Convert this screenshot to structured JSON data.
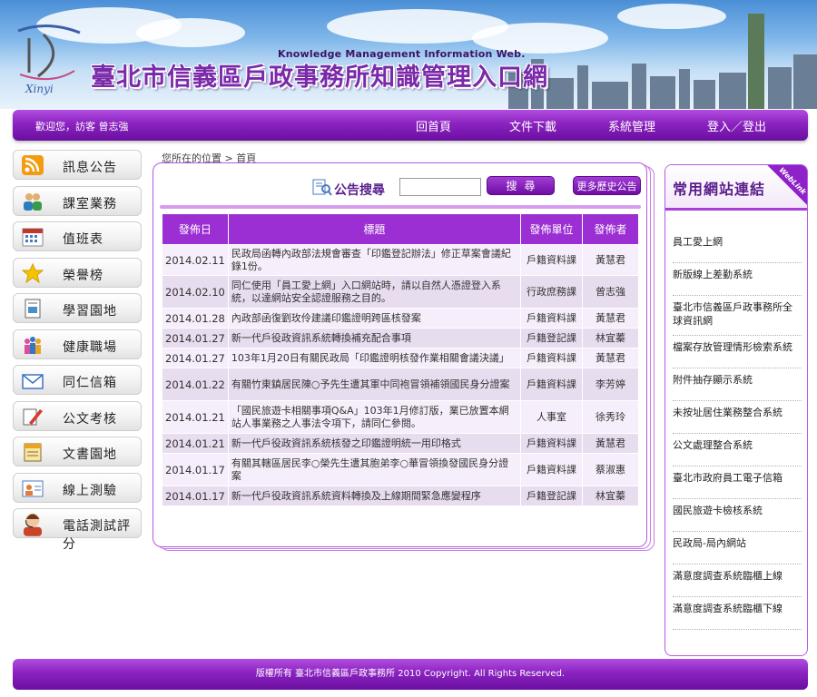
{
  "header": {
    "brand_en": "Knowledge Management Information Web.",
    "brand_zh": "臺北市信義區戶政事務所知識管理入口網",
    "logo_text": "Xinyi"
  },
  "nav": {
    "welcome": "歡迎您，訪客 曾志強",
    "home": "回首頁",
    "files": "文件下載",
    "admin": "系統管理",
    "login": "登入／登出"
  },
  "menu": [
    {
      "label": "訊息公告",
      "icon": "rss-icon",
      "color": "#f39c12"
    },
    {
      "label": "課室業務",
      "icon": "people-icon",
      "color": "#2e7bbf"
    },
    {
      "label": "值班表",
      "icon": "calendar-icon",
      "color": "#c0392b"
    },
    {
      "label": "榮譽榜",
      "icon": "star-icon",
      "color": "#f5c400"
    },
    {
      "label": "學習園地",
      "icon": "document-icon",
      "color": "#4a90c8"
    },
    {
      "label": "健康職場",
      "icon": "group-icon",
      "color": "#d64fa0"
    },
    {
      "label": "同仁信箱",
      "icon": "mail-icon",
      "color": "#3a73c6"
    },
    {
      "label": "公文考核",
      "icon": "pencil-icon",
      "color": "#d63a2a"
    },
    {
      "label": "文書園地",
      "icon": "notebook-icon",
      "color": "#e8a523"
    },
    {
      "label": "線上測驗",
      "icon": "user-card-icon",
      "color": "#e07b39"
    },
    {
      "label": "電話測試評分",
      "icon": "operator-icon",
      "color": "#c8452a"
    }
  ],
  "breadcrumb": "您所在的位置 > 首頁",
  "search": {
    "label": "公告搜尋",
    "placeholder": "",
    "button": "搜尋",
    "history_button": "更多歷史公告"
  },
  "table": {
    "headers": [
      "發佈日",
      "標題",
      "發佈單位",
      "發佈者"
    ],
    "rows": [
      {
        "date": "2014.02.11",
        "title": "民政局函轉內政部法規會審查「印鑑登記辦法」修正草案會議紀錄1份。",
        "unit": "戶籍資料課",
        "author": "黃慧君"
      },
      {
        "date": "2014.02.10",
        "title": "同仁使用「員工愛上網」入口網站時，請以自然人憑證登入系統，以達網站安全認證服務之目的。",
        "unit": "行政庶務課",
        "author": "曾志強"
      },
      {
        "date": "2014.01.28",
        "title": "內政部函復劉玫伶建議印鑑證明跨區核發案",
        "unit": "戶籍資料課",
        "author": "黃慧君"
      },
      {
        "date": "2014.01.27",
        "title": "新一代戶役政資訊系統轉換補充配合事項",
        "unit": "戶籍登記課",
        "author": "林宜蓁"
      },
      {
        "date": "2014.01.27",
        "title": "103年1月20日有關民政局「印鑑證明核發作業相關會議決議」",
        "unit": "戶籍資料課",
        "author": "黃慧君"
      },
      {
        "date": "2014.01.22",
        "title": "有關竹東鎮居民陳○予先生遭其軍中同袍冒領補領國民身分證案",
        "unit": "戶籍資料課",
        "author": "李芳婷"
      },
      {
        "date": "2014.01.21",
        "title": "「國民旅遊卡相關事項Q&A」103年1月修訂版，業已放置本網站人事業務之人事法令項下，請同仁參閱。",
        "unit": "人事室",
        "author": "徐秀玲"
      },
      {
        "date": "2014.01.21",
        "title": "新一代戶役政資訊系統核發之印鑑證明統一用印格式",
        "unit": "戶籍資料課",
        "author": "黃慧君"
      },
      {
        "date": "2014.01.17",
        "title": "有關其轄區居民李○榮先生遭其胞弟李○華冒領換發國民身分證案",
        "unit": "戶籍資料課",
        "author": "蔡淑惠"
      },
      {
        "date": "2014.01.17",
        "title": "新一代戶役政資訊系統資料轉換及上線期間緊急應變程序",
        "unit": "戶籍登記課",
        "author": "林宜蓁"
      }
    ]
  },
  "links": {
    "title": "常用網站連結",
    "ribbon": "WebLink",
    "items": [
      "員工愛上網",
      "新版線上差勤系統",
      "臺北市信義區戶政事務所全球資訊網",
      "檔案存放管理情形檢索系統",
      "附件抽存顯示系統",
      "未按址居住業務整合系統",
      "公文處理整合系統",
      "臺北市政府員工電子信箱",
      "國民旅遊卡檢核系統",
      "民政局-局內網站",
      "滿意度調查系統臨櫃上線",
      "滿意度調查系統臨櫃下線"
    ]
  },
  "footer": "版權所有 臺北市信義區戶政事務所 2010 Copyright. All Rights Reserved."
}
